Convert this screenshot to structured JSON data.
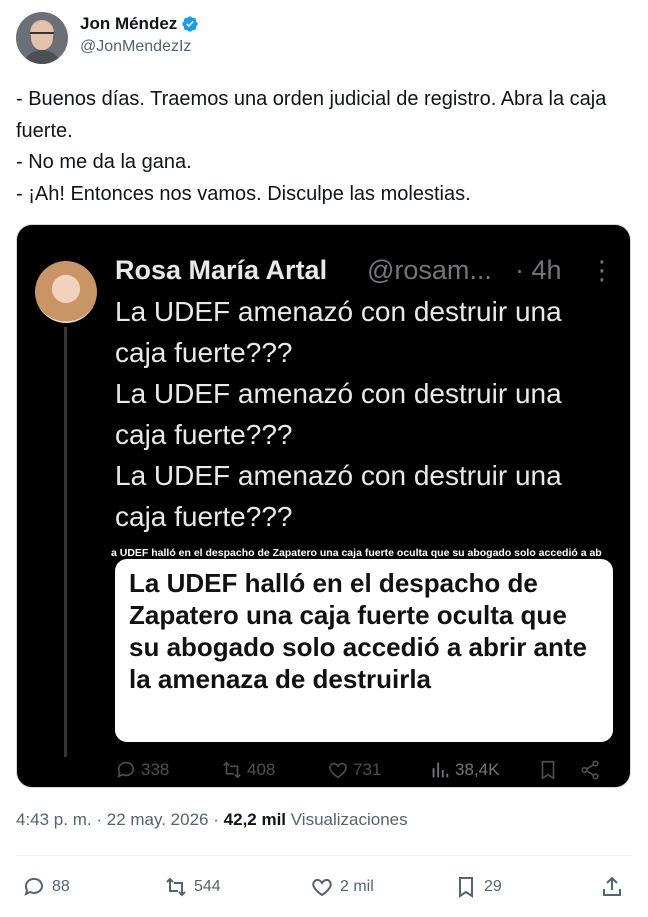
{
  "author": {
    "name": "Jon Méndez",
    "handle": "@JonMendezIz",
    "verified": true
  },
  "tweet": {
    "lines": [
      "- Buenos días. Traemos una orden judicial de registro. Abra la caja fuerte.",
      "- No me da la gana.",
      "- ¡Ah! Entonces nos vamos. Disculpe las molestias."
    ]
  },
  "quoted": {
    "name": "Rosa María Artal",
    "handle": "@rosam...",
    "time": "· 4h",
    "lines": [
      "La UDEF amenazó con destruir una caja fuerte???",
      "La UDEF amenazó con destruir una caja fuerte???",
      "La UDEF amenazó con destruir una caja fuerte???"
    ],
    "article_strip": "a UDEF halló en el despacho de Zapatero una caja fuerte oculta que su abogado solo accedió a ab",
    "article_headline": "La UDEF halló en el despacho de Zapatero una caja fuerte oculta que su abogado solo accedió a abrir ante la amenaza de destruirla",
    "stats": {
      "replies": "338",
      "reposts": "408",
      "likes": "731",
      "views": "38,4K"
    }
  },
  "meta": {
    "time": "4:43 p. m.",
    "date": "22 may. 2026",
    "sep": "·",
    "views_count": "42,2 mil",
    "views_label": "Visualizaciones"
  },
  "actions": {
    "replies": "88",
    "reposts": "544",
    "likes": "2 mil",
    "bookmarks": "29"
  },
  "colors": {
    "verified": "#1d9bf0",
    "text": "#0f1419",
    "secondary": "#536471"
  }
}
